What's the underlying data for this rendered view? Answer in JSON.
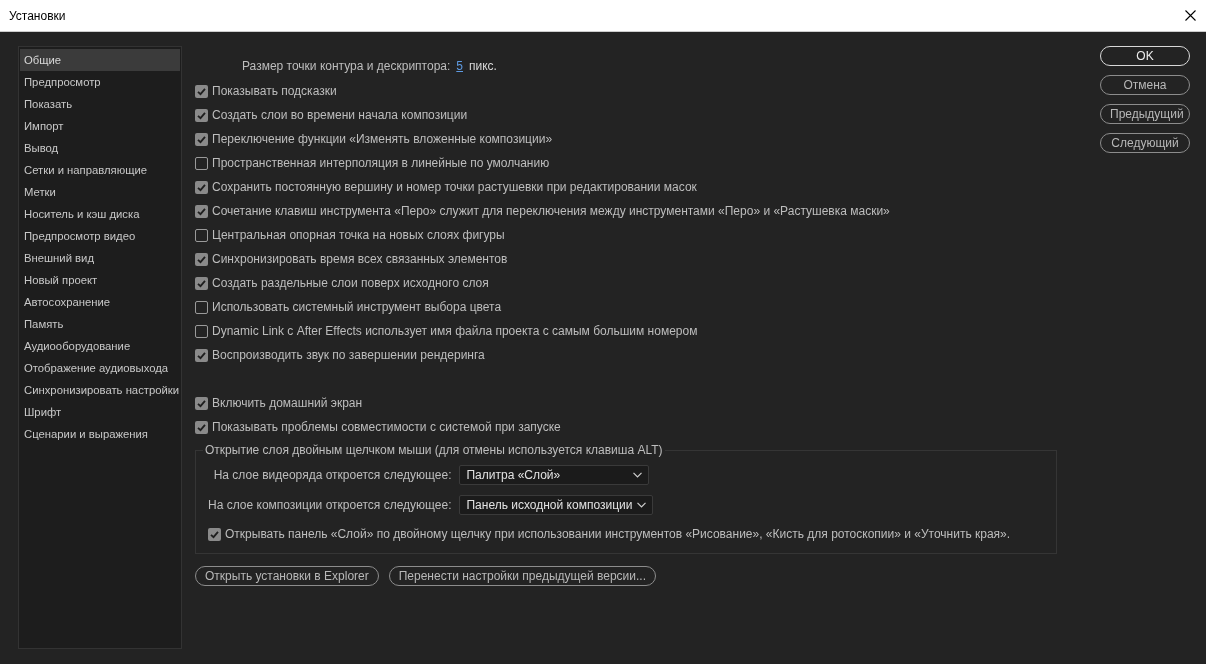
{
  "window": {
    "title": "Установки"
  },
  "sidebar": {
    "items": [
      {
        "label": "Общие",
        "selected": true
      },
      {
        "label": "Предпросмотр",
        "selected": false
      },
      {
        "label": "Показать",
        "selected": false
      },
      {
        "label": "Импорт",
        "selected": false
      },
      {
        "label": "Вывод",
        "selected": false
      },
      {
        "label": "Сетки и направляющие",
        "selected": false
      },
      {
        "label": "Метки",
        "selected": false
      },
      {
        "label": "Носитель и кэш диска",
        "selected": false
      },
      {
        "label": "Предпросмотр видео",
        "selected": false
      },
      {
        "label": "Внешний вид",
        "selected": false
      },
      {
        "label": "Новый проект",
        "selected": false
      },
      {
        "label": "Автосохранение",
        "selected": false
      },
      {
        "label": "Память",
        "selected": false
      },
      {
        "label": "Аудиооборудование",
        "selected": false
      },
      {
        "label": "Отображение аудиовыхода",
        "selected": false
      },
      {
        "label": "Синхронизировать настройки",
        "selected": false
      },
      {
        "label": "Шрифт",
        "selected": false
      },
      {
        "label": "Сценарии и выражения",
        "selected": false
      }
    ]
  },
  "contour_size": {
    "label": "Размер точки контура и дескриптора:",
    "value": "5",
    "unit": "пикс."
  },
  "options": [
    {
      "label": "Показывать подсказки",
      "checked": true
    },
    {
      "label": "Создать слои во времени начала композиции",
      "checked": true
    },
    {
      "label": "Переключение функции «Изменять вложенные композиции»",
      "checked": true
    },
    {
      "label": "Пространственная интерполяция в линейные по умолчанию",
      "checked": false
    },
    {
      "label": "Сохранить постоянную вершину и номер точки растушевки при редактировании масок",
      "checked": true
    },
    {
      "label": "Сочетание клавиш инструмента «Перо» служит для переключения между инструментами «Перо» и «Растушевка маски»",
      "checked": true
    },
    {
      "label": "Центральная опорная точка на новых слоях фигуры",
      "checked": false
    },
    {
      "label": "Синхронизировать время всех связанных элементов",
      "checked": true
    },
    {
      "label": "Создать раздельные слои поверх исходного слоя",
      "checked": true
    },
    {
      "label": "Использовать системный инструмент выбора цвета",
      "checked": false
    },
    {
      "label": "Dynamic Link с After Effects использует имя файла проекта с самым большим номером",
      "checked": false
    },
    {
      "label": "Воспроизводить звук по завершении рендеринга",
      "checked": true
    }
  ],
  "startup_options": [
    {
      "label": "Включить домашний экран",
      "checked": true
    },
    {
      "label": "Показывать проблемы совместимости с системой при запуске",
      "checked": true
    }
  ],
  "double_click_group": {
    "title": "Открытие слоя двойным щелчком мыши (для отмены используется клавиша ALT)",
    "fields": [
      {
        "label": "На слое видеоряда откроется следующее:",
        "value": "Палитра «Слой»"
      },
      {
        "label": "На слое композиции откроется следующее:",
        "value": "Панель исходной композиции"
      }
    ],
    "option": {
      "label": "Открывать панель «Слой» по двойному щелчку при использовании инструментов «Рисование», «Кисть для ротоскопии» и «Уточнить края».",
      "checked": true
    }
  },
  "bottom_buttons": [
    "Открыть установки в Explorer",
    "Перенести настройки предыдущей версии..."
  ],
  "dialog_buttons": [
    {
      "label": "OK",
      "default": true
    },
    {
      "label": "Отмена",
      "default": false
    },
    {
      "label": "Предыдущий",
      "default": false
    },
    {
      "label": "Следующий",
      "default": false
    }
  ]
}
